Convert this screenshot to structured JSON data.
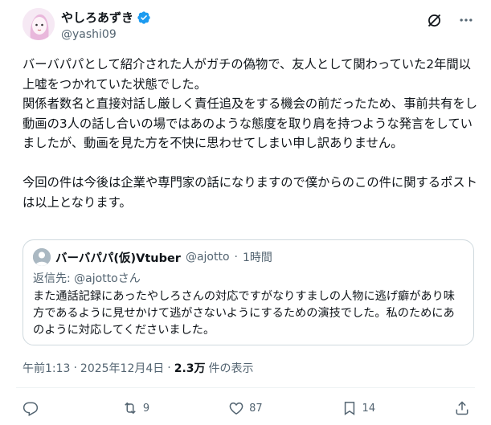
{
  "author": {
    "display_name": "やしろあずき",
    "handle": "@yashi09",
    "verified_color": "#1d9bf0",
    "avatar_icon": "avatar-image"
  },
  "header_actions": [
    {
      "icon": "grok-icon"
    },
    {
      "icon": "more-icon"
    }
  ],
  "post": {
    "text": "バーバパパとして紹介された人がガチの偽物で、友人として関わっていた2年間以上嘘をつかれていた状態でした。\n関係者数名と直接対話し厳しく責任追及をする機会の前だったため、事前共有をし動画の3人の話し合いの場ではあのような態度を取り肩を持つような発言をしていましたが、動画を見た方を不快に思わせてしまい申し訳ありません。\n\n今回の件は今後は企業や専門家の話になりますので僕からのこの件に関するポストは以上となります。"
  },
  "quote": {
    "display_name": "バーバパパ(仮)Vtuber",
    "handle": "@ajotto",
    "separator": "·",
    "time": "1時間",
    "reply_label": "返信先: ",
    "reply_to": "@ajottoさん",
    "text": "また通話記録にあったやしろさんの対応ですがなりすましの人物に逃げ癖があり味方であるように見せかけて逃がさないようにするための演技でした。私のためにあのように対応してくださいました。"
  },
  "meta": {
    "time": "午前1:13",
    "separator": "·",
    "date": "2025年12月4日",
    "separator2": "·",
    "views": "2.3万",
    "views_label": "件の表示"
  },
  "actions": {
    "reply": {
      "icon": "reply-icon",
      "count": ""
    },
    "repost": {
      "icon": "repost-icon",
      "count": "9"
    },
    "like": {
      "icon": "like-icon",
      "count": "87"
    },
    "bookmark": {
      "icon": "bookmark-icon",
      "count": "14"
    },
    "share": {
      "icon": "share-icon",
      "count": ""
    }
  }
}
